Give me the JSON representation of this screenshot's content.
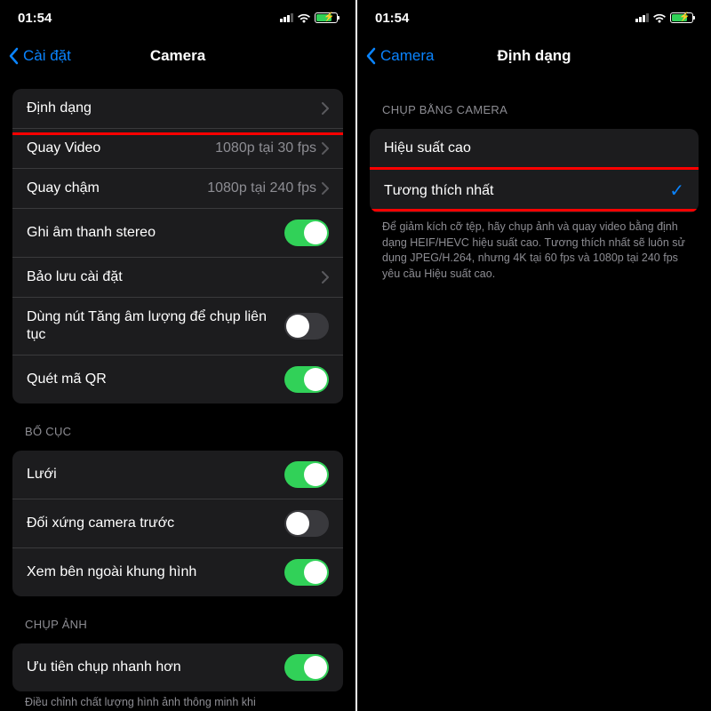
{
  "status": {
    "time": "01:54"
  },
  "left": {
    "back_label": "Cài đặt",
    "title": "Camera",
    "rows": {
      "format": {
        "label": "Định dạng"
      },
      "record_video": {
        "label": "Quay Video",
        "value": "1080p tại 30 fps"
      },
      "slow_mo": {
        "label": "Quay chậm",
        "value": "1080p tại 240 fps"
      },
      "stereo": {
        "label": "Ghi âm thanh stereo"
      },
      "preserve": {
        "label": "Bảo lưu cài đặt"
      },
      "volume_burst": {
        "label": "Dùng nút Tăng âm lượng để chụp liên tục"
      },
      "qr": {
        "label": "Quét mã QR"
      }
    },
    "section_composition": "BỐ CỤC",
    "composition": {
      "grid": {
        "label": "Lưới"
      },
      "mirror": {
        "label": "Đối xứng camera trước"
      },
      "outside_frame": {
        "label": "Xem bên ngoài khung hình"
      }
    },
    "section_capture": "CHỤP ẢNH",
    "capture": {
      "prioritize": {
        "label": "Ưu tiên chụp nhanh hơn"
      }
    },
    "footer_cut": "Điều chỉnh chất lượng hình ảnh thông minh khi"
  },
  "right": {
    "back_label": "Camera",
    "title": "Định dạng",
    "section_label": "CHỤP BẰNG CAMERA",
    "option_high": "Hiệu suất cao",
    "option_compat": "Tương thích nhất",
    "footer": "Để giảm kích cỡ tệp, hãy chụp ảnh và quay video bằng định dạng HEIF/HEVC hiệu suất cao. Tương thích nhất sẽ luôn sử dụng JPEG/H.264, nhưng 4K tại 60 fps và 1080p tại 240 fps yêu cầu Hiệu suất cao."
  }
}
